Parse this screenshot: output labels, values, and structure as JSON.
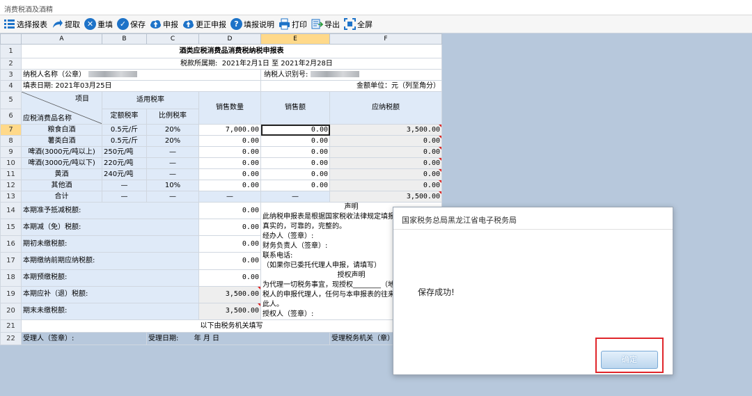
{
  "window": {
    "title": "消费税酒及酒精"
  },
  "toolbar": {
    "items": [
      {
        "label": "选择报表",
        "icon": "list-icon"
      },
      {
        "label": "提取",
        "icon": "redo-arrow-icon"
      },
      {
        "label": "重填",
        "icon": "reset-x-icon"
      },
      {
        "label": "保存",
        "icon": "check-icon"
      },
      {
        "label": "申报",
        "icon": "cloud-upload-icon"
      },
      {
        "label": "更正申报",
        "icon": "cloud-upload-icon"
      },
      {
        "label": "填报说明",
        "icon": "help-icon"
      },
      {
        "label": "打印",
        "icon": "printer-icon"
      },
      {
        "label": "导出",
        "icon": "export-icon"
      },
      {
        "label": "全屏",
        "icon": "fullscreen-icon"
      }
    ]
  },
  "sheet": {
    "columns": [
      "A",
      "B",
      "C",
      "D",
      "E",
      "F"
    ],
    "selected_column": "E",
    "selected_row": "7",
    "row_numbers": [
      "1",
      "2",
      "3",
      "4",
      "5",
      "6",
      "7",
      "8",
      "9",
      "10",
      "11",
      "12",
      "13",
      "14",
      "15",
      "16",
      "17",
      "18",
      "19",
      "20",
      "21",
      "22"
    ],
    "title": "酒类应税消费品消费税纳税申报表",
    "period_label": "税款所属期:",
    "period_value": "2021年2月1日 至 2021年2月28日",
    "taxpayer_name_label": "纳税人名称（公章）",
    "taxpayer_id_label": "纳税人识别号:",
    "fill_date": "填表日期: 2021年03月25日",
    "unit": "金额单位：元（列至角分）",
    "hdr_item": "项目",
    "hdr_product": "应税消费品名称",
    "hdr_rate": "适用税率",
    "hdr_fixed_rate": "定额税率",
    "hdr_ratio_rate": "比例税率",
    "hdr_qty": "销售数量",
    "hdr_sales": "销售额",
    "hdr_tax": "应纳税额",
    "rows": [
      {
        "name": "粮食白酒",
        "fixed": "0.5元/斤",
        "ratio": "20%",
        "qty": "7,000.00",
        "sales": "0.00",
        "tax": "3,500.00"
      },
      {
        "name": "薯类白酒",
        "fixed": "0.5元/斤",
        "ratio": "20%",
        "qty": "0.00",
        "sales": "0.00",
        "tax": "0.00"
      },
      {
        "name": "啤酒(3000元/吨以上)",
        "fixed": "250元/吨",
        "ratio": "—",
        "qty": "0.00",
        "sales": "0.00",
        "tax": "0.00"
      },
      {
        "name": "啤酒(3000元/吨以下)",
        "fixed": "220元/吨",
        "ratio": "—",
        "qty": "0.00",
        "sales": "0.00",
        "tax": "0.00"
      },
      {
        "name": "黄酒",
        "fixed": "240元/吨",
        "ratio": "—",
        "qty": "0.00",
        "sales": "0.00",
        "tax": "0.00"
      },
      {
        "name": "其他酒",
        "fixed": "—",
        "ratio": "10%",
        "qty": "0.00",
        "sales": "0.00",
        "tax": "0.00"
      }
    ],
    "total": {
      "name": "合计",
      "fixed": "—",
      "ratio": "—",
      "qty": "—",
      "sales": "—",
      "tax": "3,500.00"
    },
    "summary": [
      {
        "label": "本期准予抵减税额:",
        "value": "0.00"
      },
      {
        "label": "本期减（免）税额:",
        "value": "0.00"
      },
      {
        "label": "期初未缴税额:",
        "value": "0.00"
      },
      {
        "label": "本期缴纳前期应纳税额:",
        "value": "0.00"
      },
      {
        "label": "本期预缴税额:",
        "value": "0.00"
      },
      {
        "label": "本期应补（退）税额:",
        "value": "3,500.00"
      },
      {
        "label": "期末未缴税额:",
        "value": "3,500.00"
      }
    ],
    "declaration": {
      "l1": "声明",
      "l2": "此纳税申报表是根据国家税收法律规定填报的",
      "l3": "真实的，可靠的，完整的。",
      "l4": "经办人（签章）:",
      "l5": "财务负责人（签章）:",
      "l6": "联系电话:",
      "l7": "（如果你已委托代理人申报，请填写）",
      "l8": "授权声明",
      "l9": "为代理一切税务事宜，现授权________（地址",
      "l10": "税人的申报代理人，任何与本申报表的往来文",
      "l11": "此人。",
      "l12": "授权人（签章）:"
    },
    "office_fill": "以下由税务机关填写",
    "receiver": "受理人（签章）:",
    "receive_date": "受理日期:",
    "date_fmt": "年    月    日",
    "receive_office": "受理税务机关（章）"
  },
  "dialog": {
    "title": "国家税务总局黑龙江省电子税务局",
    "message": "保存成功!",
    "ok_label": "确定"
  }
}
